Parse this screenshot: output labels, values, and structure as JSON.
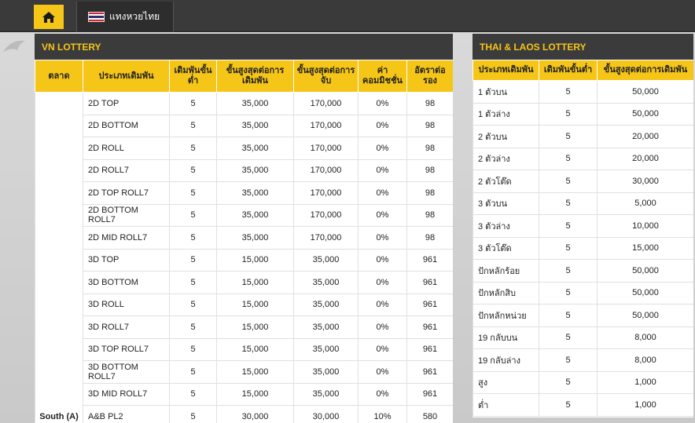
{
  "topbar": {
    "lang_label": "แทงหวยไทย"
  },
  "vn": {
    "title": "VN LOTTERY",
    "headers": [
      "ตลาด",
      "ประเภทเดิมพัน",
      "เดิมพันขั้นต่ำ",
      "ขั้นสูงสุดต่อการเดิมพัน",
      "ขั้นสูงสุดต่อการจับ",
      "ค่าคอมมิชชั่น",
      "อัตราต่อรอง"
    ],
    "market": "South (A)",
    "rows": [
      [
        "2D TOP",
        "5",
        "35,000",
        "170,000",
        "0%",
        "98"
      ],
      [
        "2D BOTTOM",
        "5",
        "35,000",
        "170,000",
        "0%",
        "98"
      ],
      [
        "2D ROLL",
        "5",
        "35,000",
        "170,000",
        "0%",
        "98"
      ],
      [
        "2D ROLL7",
        "5",
        "35,000",
        "170,000",
        "0%",
        "98"
      ],
      [
        "2D TOP ROLL7",
        "5",
        "35,000",
        "170,000",
        "0%",
        "98"
      ],
      [
        "2D BOTTOM ROLL7",
        "5",
        "35,000",
        "170,000",
        "0%",
        "98"
      ],
      [
        "2D MID ROLL7",
        "5",
        "35,000",
        "170,000",
        "0%",
        "98"
      ],
      [
        "3D TOP",
        "5",
        "15,000",
        "35,000",
        "0%",
        "961"
      ],
      [
        "3D BOTTOM",
        "5",
        "15,000",
        "35,000",
        "0%",
        "961"
      ],
      [
        "3D ROLL",
        "5",
        "15,000",
        "35,000",
        "0%",
        "961"
      ],
      [
        "3D ROLL7",
        "5",
        "15,000",
        "35,000",
        "0%",
        "961"
      ],
      [
        "3D TOP ROLL7",
        "5",
        "15,000",
        "35,000",
        "0%",
        "961"
      ],
      [
        "3D BOTTOM ROLL7",
        "5",
        "15,000",
        "35,000",
        "0%",
        "961"
      ],
      [
        "3D MID ROLL7",
        "5",
        "15,000",
        "35,000",
        "0%",
        "961"
      ],
      [
        "A&B PL2",
        "5",
        "30,000",
        "30,000",
        "10%",
        "580"
      ]
    ]
  },
  "thai": {
    "title": "THAI & LAOS LOTTERY",
    "headers": [
      "ประเภทเดิมพัน",
      "เดิมพันขั้นต่ำ",
      "ขั้นสูงสุดต่อการเดิมพัน"
    ],
    "rows": [
      [
        "1 ตัวบน",
        "5",
        "50,000"
      ],
      [
        "1 ตัวล่าง",
        "5",
        "50,000"
      ],
      [
        "2 ตัวบน",
        "5",
        "20,000"
      ],
      [
        "2 ตัวล่าง",
        "5",
        "20,000"
      ],
      [
        "2 ตัวโต๊ด",
        "5",
        "30,000"
      ],
      [
        "3 ตัวบน",
        "5",
        "5,000"
      ],
      [
        "3 ตัวล่าง",
        "5",
        "10,000"
      ],
      [
        "3 ตัวโต๊ด",
        "5",
        "15,000"
      ],
      [
        "ปักหลักร้อย",
        "5",
        "50,000"
      ],
      [
        "ปักหลักสิบ",
        "5",
        "50,000"
      ],
      [
        "ปักหลักหน่วย",
        "5",
        "50,000"
      ],
      [
        "19 กลับบน",
        "5",
        "8,000"
      ],
      [
        "19 กลับล่าง",
        "5",
        "8,000"
      ],
      [
        "สูง",
        "5",
        "1,000"
      ],
      [
        "ต่ำ",
        "5",
        "1,000"
      ]
    ]
  },
  "colors": {
    "accent": "#f5c518",
    "header_dark": "#3b3b3b",
    "topbar": "#3a3a3a"
  }
}
